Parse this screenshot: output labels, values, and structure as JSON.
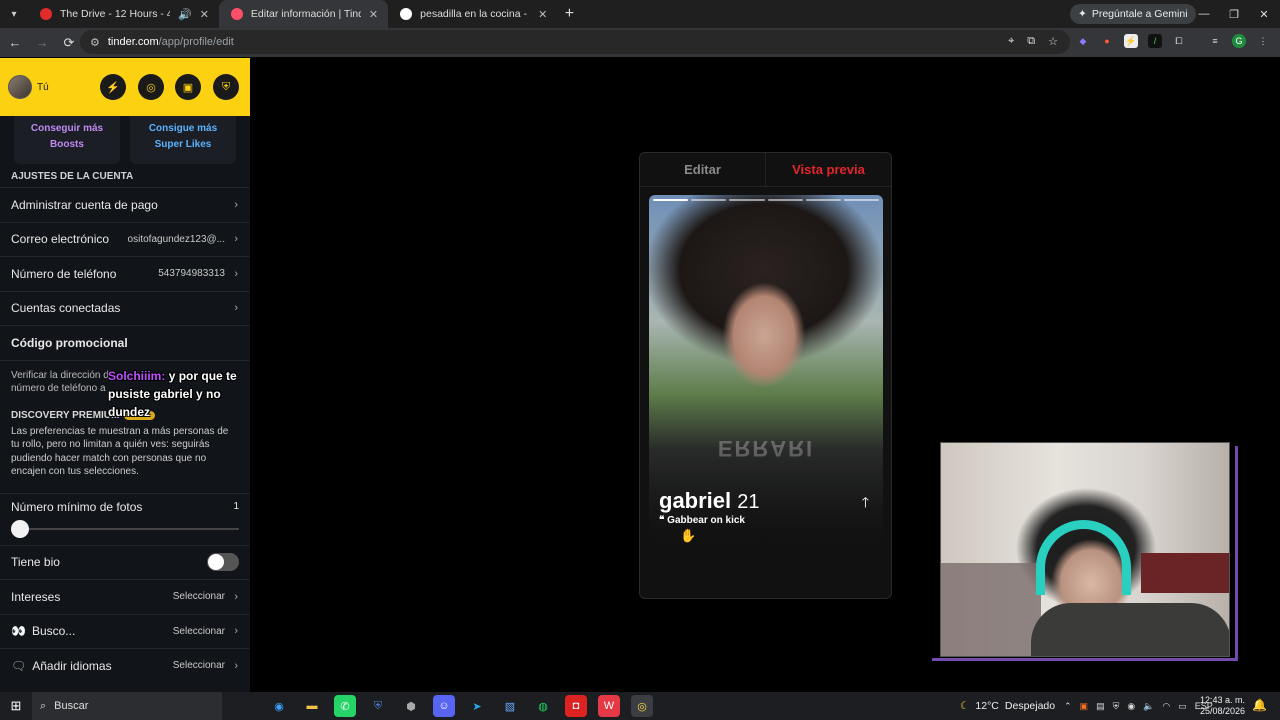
{
  "browser": {
    "tabs": [
      {
        "title": "The Drive - 12 Hours - 4K U",
        "fav_color": "#e22b2b",
        "active": false
      },
      {
        "title": "Editar información | Tinder",
        "fav_color": "#fd4f68",
        "active": true
      },
      {
        "title": "pesadilla en la cocina - Google",
        "fav_color": "#ffffff",
        "active": false
      }
    ],
    "gemini_label": "Pregúntale a Gemini",
    "url_host": "tinder.com",
    "url_path": "/app/profile/edit",
    "profile_initial": "G"
  },
  "sidebar": {
    "user_name": "Tú",
    "boosts": {
      "line1": "Conseguir más",
      "line2": "Boosts"
    },
    "superlikes": {
      "line1": "Consigue más",
      "line2": "Super Likes"
    },
    "account_title": "AJUSTES DE LA CUENTA",
    "rows": [
      {
        "label": "Administrar cuenta de pago",
        "value": ""
      },
      {
        "label": "Correo electrónico",
        "value": "ositofagundez123@..."
      },
      {
        "label": "Número de teléfono",
        "value": "543794983313"
      },
      {
        "label": "Cuentas conectadas",
        "value": ""
      },
      {
        "label": "Código promocional",
        "value": ""
      }
    ],
    "verify_text_1": "Verificar la dirección de",
    "verify_text_2": "número de teléfono a",
    "overlay_user": "Solchiiim:",
    "overlay_message": "y por que te pusiste gabriel y no dundez",
    "discovery_title": "DISCOVERY PREMIUM",
    "gold_badge": "GOLD",
    "discovery_desc": "Las preferencias te muestran a más personas de tu rollo, pero no limitan a quién ves: seguirás pudiendo hacer match con personas que no encajen con tus selecciones.",
    "min_photos_label": "Número mínimo de fotos",
    "min_photos_value": "1",
    "has_bio_label": "Tiene bio",
    "interests_label": "Intereses",
    "interests_value": "Seleccionar",
    "looking_label": "Busco...",
    "looking_value": "Seleccionar",
    "languages_label": "Añadir idiomas",
    "languages_value": "Seleccionar"
  },
  "card": {
    "tab_edit": "Editar",
    "tab_preview": "Vista previa",
    "name": "gabriel",
    "age": "21",
    "bio": "Gabbear on kick",
    "shirt_text": "ERRARI"
  },
  "taskbar": {
    "search": "Buscar",
    "weather_temp": "12°C",
    "weather_desc": "Despejado",
    "lang": "ESP",
    "time": "12:43 a. m.",
    "date": "25/08/2026"
  }
}
